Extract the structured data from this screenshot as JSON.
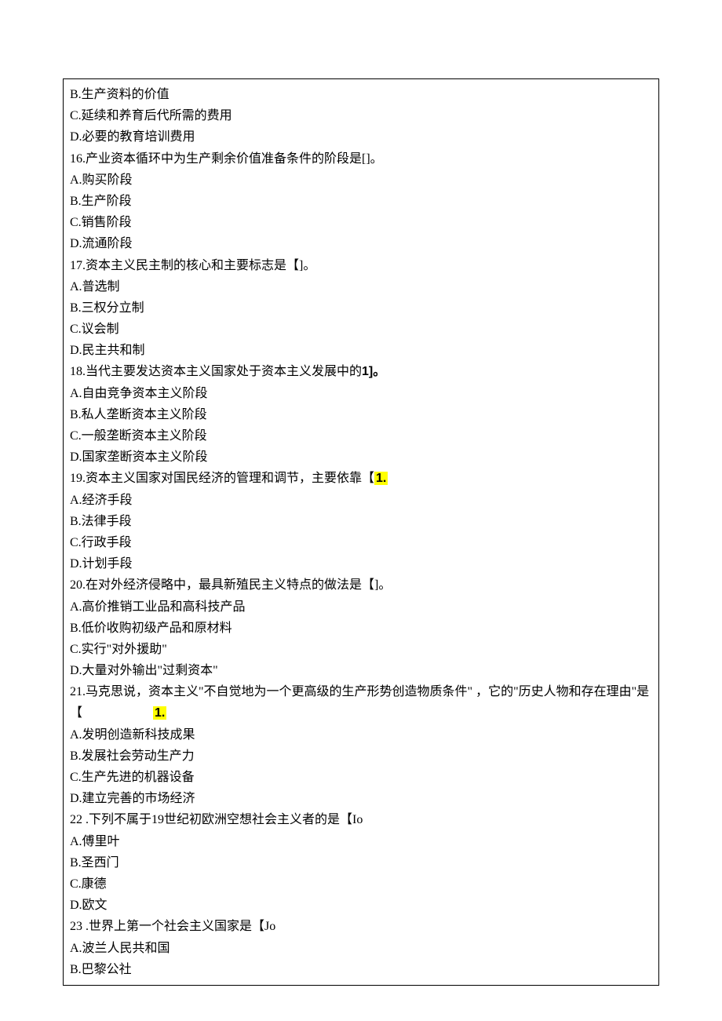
{
  "lines": {
    "l1": "B.生产资料的价值",
    "l2": "C.延续和养育后代所需的费用",
    "l3": "D.必要的教育培训费用",
    "l4": "16.产业资本循环中为生产剩余价值准备条件的阶段是[]。",
    "l5": "A.购买阶段",
    "l6": "B.生产阶段",
    "l7": "C.销售阶段",
    "l8": "D.流通阶段",
    "l9": "17.资本主义民主制的核心和主要标志是【]。",
    "l10": "A.普选制",
    "l11": "B.三权分立制",
    "l12": "C.议会制",
    "l13": "D.民主共和制",
    "l14_a": "18.当代主要发达资本主义国家处于资本主义发展中的",
    "l14_b": "1]。",
    "l15": "A.自由竞争资本主义阶段",
    "l16": "B.私人垄断资本主义阶段",
    "l17": "C.一般垄断资本主义阶段",
    "l18": "D.国家垄断资本主义阶段",
    "l19_a": "19.资本主义国家对国民经济的管理和调节，主要依靠【",
    "l19_b": "1.",
    "l20": "A.经济手段",
    "l21": "B.法律手段",
    "l22": "C.行政手段",
    "l23": "D.计划手段",
    "l24": "20.在对外经济侵略中，最具新殖民主义特点的做法是【]。",
    "l25": "A.高价推销工业品和高科技产品",
    "l26": "B.低价收购初级产品和原材料",
    "l27": "C.实行\"对外援助\"",
    "l28": "D.大量对外输出\"过剩资本\"",
    "l29": "21.马克思说，资本主义\"不自觉地为一个更高级的生产形势创造物质条件\" ，它的\"历史人物和存在理由\"是【",
    "l29_hl": "1.",
    "l30": "A.发明创造新科技成果",
    "l31": "B.发展社会劳动生产力",
    "l32": "C.生产先进的机器设备",
    "l33": "D.建立完善的市场经济",
    "l34": "22 .下列不属于19世纪初欧洲空想社会主义者的是【Io",
    "l35": "A.傅里叶",
    "l36": "B.圣西门",
    "l37": "C.康德",
    "l38": "D.欧文",
    "l39": "23 .世界上第一个社会主义国家是【Jo",
    "l40": "A.波兰人民共和国",
    "l41": "B.巴黎公社"
  }
}
